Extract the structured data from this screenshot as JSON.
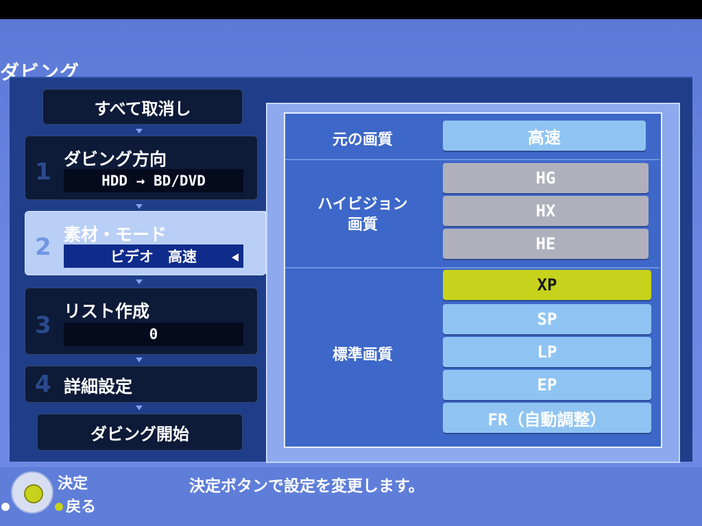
{
  "screen_title": "ダビング",
  "cancel_all": "すべて取消し",
  "steps": [
    {
      "num": "1",
      "label": "ダビング方向",
      "value": "HDD → BD/DVD"
    },
    {
      "num": "2",
      "label": "素材・モード",
      "value": "ビデオ　高速"
    },
    {
      "num": "3",
      "label": "リスト作成",
      "value": "0"
    },
    {
      "num": "4",
      "label": "詳細設定"
    }
  ],
  "start_dubbing": "ダビング開始",
  "quality": {
    "original_label": "元の画質",
    "original_value": "高速",
    "hivision_label": "ハイビジョン\n画質",
    "hivision_options": [
      "HG",
      "HX",
      "HE"
    ],
    "standard_label": "標準画質",
    "standard_options": [
      "XP",
      "SP",
      "LP",
      "EP",
      "FR（自動調整）"
    ],
    "selected": "XP"
  },
  "footer": {
    "decide": "決定",
    "back": "戻る",
    "hint": "決定ボタンで設定を変更します。"
  },
  "colors": {
    "selected": "#c7d21c",
    "option": "#8fc4f2",
    "disabled": "#b0b0bd",
    "panel": "#1f3d88"
  }
}
